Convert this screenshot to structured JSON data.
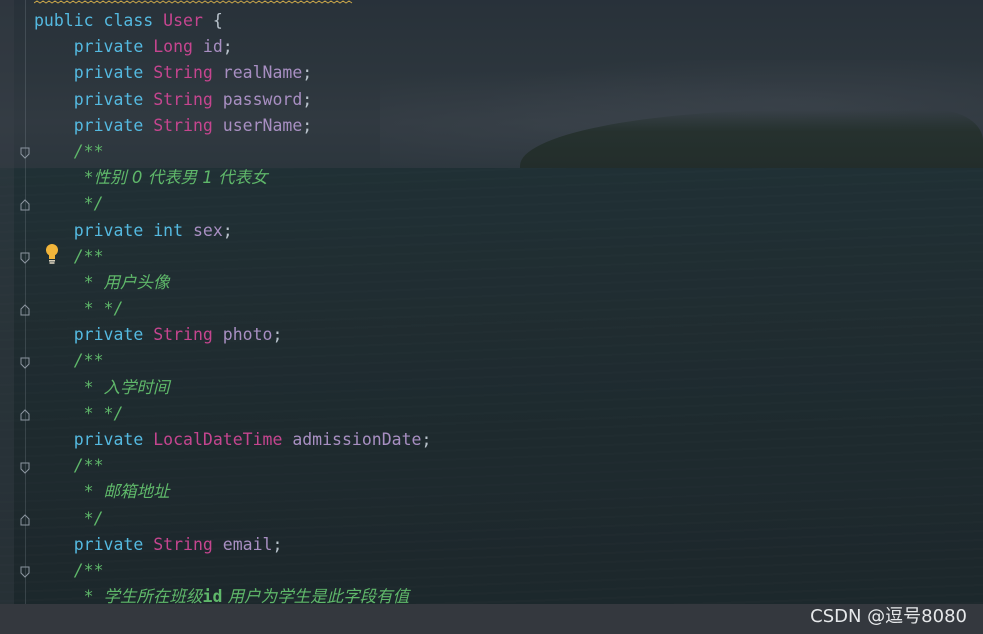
{
  "editor": {
    "lines": [
      [
        {
          "c": "kw",
          "t": "public"
        },
        {
          "c": "pu",
          "t": " "
        },
        {
          "c": "kw",
          "t": "class"
        },
        {
          "c": "pu",
          "t": " "
        },
        {
          "c": "ty",
          "t": "User"
        },
        {
          "c": "pu",
          "t": " {"
        }
      ],
      [
        {
          "c": "pu",
          "t": "    "
        },
        {
          "c": "kw",
          "t": "private"
        },
        {
          "c": "pu",
          "t": " "
        },
        {
          "c": "ty",
          "t": "Long"
        },
        {
          "c": "pu",
          "t": " "
        },
        {
          "c": "id",
          "t": "id"
        },
        {
          "c": "pu",
          "t": ";"
        }
      ],
      [
        {
          "c": "pu",
          "t": "    "
        },
        {
          "c": "kw",
          "t": "private"
        },
        {
          "c": "pu",
          "t": " "
        },
        {
          "c": "ty",
          "t": "String"
        },
        {
          "c": "pu",
          "t": " "
        },
        {
          "c": "id",
          "t": "realName"
        },
        {
          "c": "pu",
          "t": ";"
        }
      ],
      [
        {
          "c": "pu",
          "t": "    "
        },
        {
          "c": "kw",
          "t": "private"
        },
        {
          "c": "pu",
          "t": " "
        },
        {
          "c": "ty",
          "t": "String"
        },
        {
          "c": "pu",
          "t": " "
        },
        {
          "c": "id",
          "t": "password"
        },
        {
          "c": "pu",
          "t": ";"
        }
      ],
      [
        {
          "c": "pu",
          "t": "    "
        },
        {
          "c": "kw",
          "t": "private"
        },
        {
          "c": "pu",
          "t": " "
        },
        {
          "c": "ty",
          "t": "String"
        },
        {
          "c": "pu",
          "t": " "
        },
        {
          "c": "id",
          "t": "userName"
        },
        {
          "c": "pu",
          "t": ";"
        }
      ],
      [
        {
          "c": "pu",
          "t": "    "
        },
        {
          "c": "cm",
          "t": "/**"
        }
      ],
      [
        {
          "c": "pu",
          "t": "     "
        },
        {
          "c": "cm",
          "t": "*"
        },
        {
          "c": "cm-doc",
          "t": "性别 0 代表男 1 代表女"
        }
      ],
      [
        {
          "c": "pu",
          "t": "     "
        },
        {
          "c": "cm",
          "t": "*/"
        }
      ],
      [
        {
          "c": "pu",
          "t": "    "
        },
        {
          "c": "kw",
          "t": "private"
        },
        {
          "c": "pu",
          "t": " "
        },
        {
          "c": "kw",
          "t": "int"
        },
        {
          "c": "pu",
          "t": " "
        },
        {
          "c": "id",
          "t": "sex"
        },
        {
          "c": "pu",
          "t": ";"
        }
      ],
      [
        {
          "c": "pu",
          "t": "    "
        },
        {
          "c": "cm",
          "t": "/**"
        }
      ],
      [
        {
          "c": "pu",
          "t": "     "
        },
        {
          "c": "cm",
          "t": "* "
        },
        {
          "c": "cm-doc",
          "t": "用户头像"
        }
      ],
      [
        {
          "c": "pu",
          "t": "     "
        },
        {
          "c": "cm",
          "t": "* */"
        }
      ],
      [
        {
          "c": "pu",
          "t": "    "
        },
        {
          "c": "kw",
          "t": "private"
        },
        {
          "c": "pu",
          "t": " "
        },
        {
          "c": "ty",
          "t": "String"
        },
        {
          "c": "pu",
          "t": " "
        },
        {
          "c": "id",
          "t": "photo"
        },
        {
          "c": "pu",
          "t": ";"
        }
      ],
      [
        {
          "c": "pu",
          "t": "    "
        },
        {
          "c": "cm",
          "t": "/**"
        }
      ],
      [
        {
          "c": "pu",
          "t": "     "
        },
        {
          "c": "cm",
          "t": "* "
        },
        {
          "c": "cm-doc",
          "t": "入学时间"
        }
      ],
      [
        {
          "c": "pu",
          "t": "     "
        },
        {
          "c": "cm",
          "t": "* */"
        }
      ],
      [
        {
          "c": "pu",
          "t": "    "
        },
        {
          "c": "kw",
          "t": "private"
        },
        {
          "c": "pu",
          "t": " "
        },
        {
          "c": "ty",
          "t": "LocalDateTime"
        },
        {
          "c": "pu",
          "t": " "
        },
        {
          "c": "id",
          "t": "admissionDate"
        },
        {
          "c": "pu",
          "t": ";"
        }
      ],
      [
        {
          "c": "pu",
          "t": "    "
        },
        {
          "c": "cm",
          "t": "/**"
        }
      ],
      [
        {
          "c": "pu",
          "t": "     "
        },
        {
          "c": "cm",
          "t": "* "
        },
        {
          "c": "cm-doc",
          "t": "邮箱地址"
        }
      ],
      [
        {
          "c": "pu",
          "t": "     "
        },
        {
          "c": "cm",
          "t": "*/"
        }
      ],
      [
        {
          "c": "pu",
          "t": "    "
        },
        {
          "c": "kw",
          "t": "private"
        },
        {
          "c": "pu",
          "t": " "
        },
        {
          "c": "ty",
          "t": "String"
        },
        {
          "c": "pu",
          "t": " "
        },
        {
          "c": "id",
          "t": "email"
        },
        {
          "c": "pu",
          "t": ";"
        }
      ],
      [
        {
          "c": "pu",
          "t": "    "
        },
        {
          "c": "cm",
          "t": "/**"
        }
      ],
      [
        {
          "c": "pu",
          "t": "     "
        },
        {
          "c": "cm",
          "t": "* "
        },
        {
          "c": "cm-doc",
          "t": "学生所在班级"
        },
        {
          "c": "cm-id",
          "t": "id"
        },
        {
          "c": "cm-doc",
          "t": " 用户为学生是此字段有值"
        }
      ]
    ]
  },
  "gutter": {
    "fold_icons": "fold-marker-icon",
    "intention_icon": "lightbulb-icon"
  },
  "watermark": {
    "text": "CSDN @逗号8080"
  },
  "colors": {
    "keyword": "#54b9e0",
    "type": "#c5458f",
    "identifier": "#a88fc2",
    "comment": "#5fb86a",
    "bulb": "#f2b53a"
  }
}
